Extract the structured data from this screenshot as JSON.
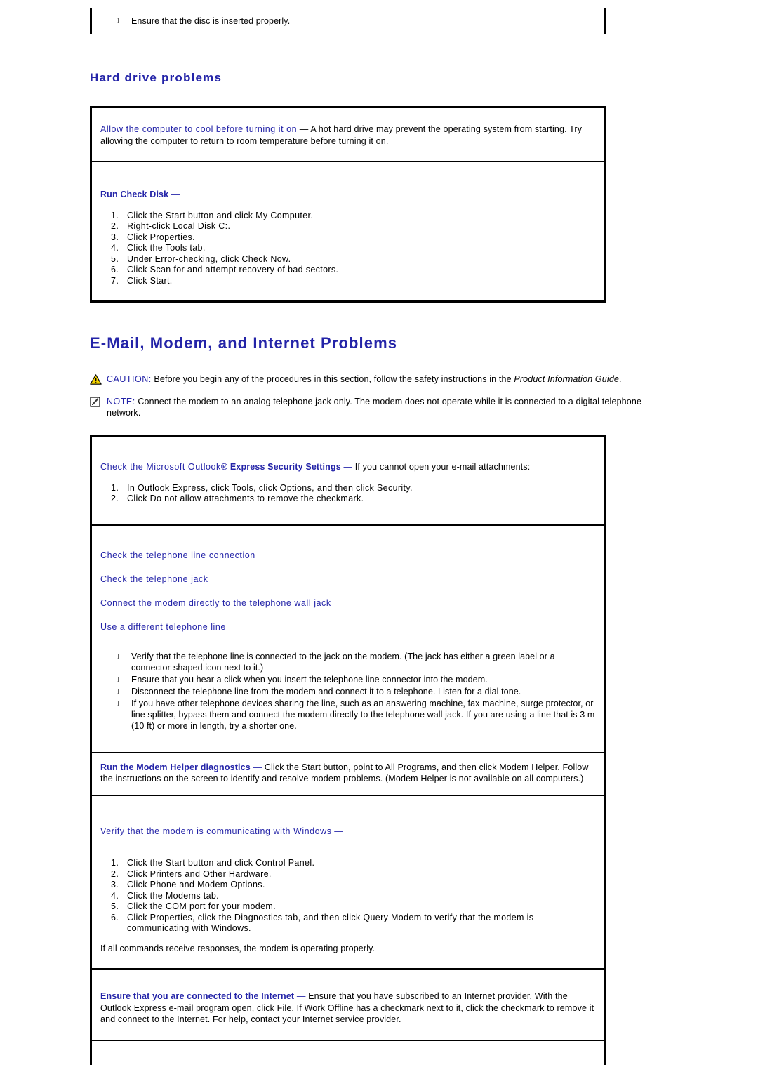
{
  "top_table": {
    "bullets": [
      "Ensure that the disc is inserted properly."
    ]
  },
  "hard_drive": {
    "heading": "Hard drive problems",
    "rows": [
      {
        "lead": "Allow the computer to cool before turning it on",
        "dash": "—",
        "body": "A hot hard drive may prevent the operating system from starting. Try allowing the computer to return to room temperature before turning it on."
      },
      {
        "lead": "Run Check Disk",
        "dash": "—",
        "steps": [
          "Click the Start button and click My Computer.",
          "Right-click Local Disk C:.",
          "Click Properties.",
          "Click the Tools tab.",
          "Under Error-checking, click Check Now.",
          "Click Scan for and attempt recovery of bad sectors.",
          "Click Start."
        ]
      }
    ]
  },
  "email_section": {
    "heading": "E-Mail, Modem, and Internet Problems",
    "caution": {
      "icon": "caution-triangle-icon",
      "keyword": "CAUTION:",
      "text_before": " Before you begin any of the procedures in this section, follow the safety instructions in the ",
      "italic": "Product Information Guide",
      "text_after": "."
    },
    "note": {
      "icon": "note-pencil-icon",
      "keyword": "NOTE:",
      "text": " Connect the modem to an analog telephone jack only. The modem does not operate while it is connected to a digital telephone network."
    },
    "rows": [
      {
        "lead_light": "Check the Microsoft Outlook",
        "registered": "®",
        "lead_bold": " Express Security Settings",
        "dash": "—",
        "body": "If you cannot open your e-mail attachments:",
        "steps": [
          "In Outlook Express, click Tools, click Options, and then click Security.",
          "Click Do not allow attachments to remove the checkmark."
        ]
      },
      {
        "subheads": [
          "Check the telephone line connection",
          "Check the telephone jack",
          "Connect the modem directly to the telephone wall jack",
          "Use a different telephone line"
        ],
        "bullets": [
          "Verify that the telephone line is connected to the jack on the modem. (The jack has either a green label or a connector-shaped icon next to it.)",
          "Ensure that you hear a click when you insert the telephone line connector into the modem.",
          "Disconnect the telephone line from the modem and connect it to a telephone. Listen for a dial tone.",
          "If you have other telephone devices sharing the line, such as an answering machine, fax machine, surge protector, or line splitter, bypass them and connect the modem directly to the telephone wall jack. If you are using a line that is 3 m (10 ft) or more in length, try a shorter one."
        ]
      },
      {
        "lead_bold": "Run the Modem Helper diagnostics",
        "dash": "—",
        "body": "Click the Start button, point to All Programs, and then click Modem Helper. Follow the instructions on the screen to identify and resolve modem problems. (Modem Helper is not available on all computers.)"
      },
      {
        "lead": "Verify that the modem is communicating with Windows",
        "dash": "—",
        "steps": [
          "Click the Start button and click Control Panel.",
          "Click Printers and Other Hardware.",
          "Click Phone and Modem Options.",
          "Click the Modems tab.",
          "Click the COM port for your modem.",
          "Click Properties, click the Diagnostics tab, and then click Query Modem to verify that the modem is communicating with Windows."
        ],
        "closing": "If all commands receive responses, the modem is operating properly."
      },
      {
        "lead_bold": "Ensure that you are connected to the Internet",
        "dash": "—",
        "body": "Ensure that you have subscribed to an Internet provider. With the Outlook Express e-mail program open, click File. If Work Offline has a checkmark next to it, click the checkmark to remove it and connect to the Internet. For help, contact your Internet service provider."
      }
    ]
  },
  "colors": {
    "heading_blue": "#2424a8",
    "caution_yellow": "#f5d300",
    "rule_gray": "#b9b9b9"
  }
}
